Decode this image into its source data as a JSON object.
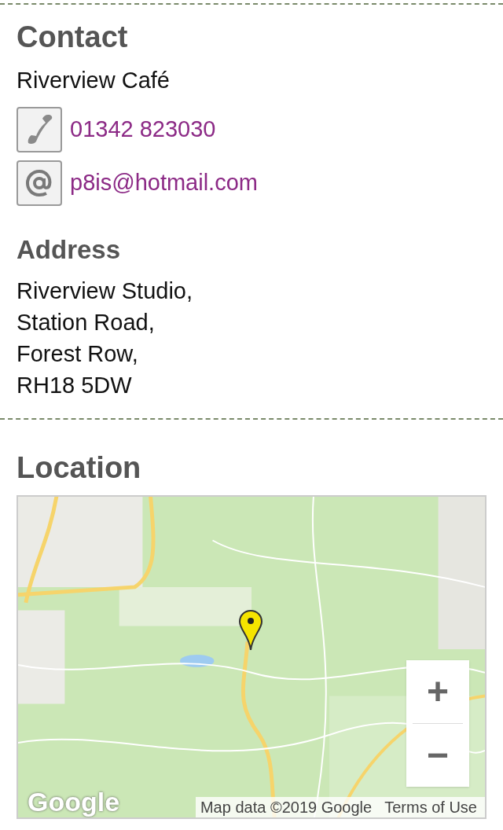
{
  "contact": {
    "heading": "Contact",
    "name": "Riverview Café",
    "links": [
      {
        "kind": "phone",
        "text": "01342 823030"
      },
      {
        "kind": "email",
        "text": "p8is@hotmail.com"
      }
    ]
  },
  "address": {
    "heading": "Address",
    "lines": [
      "Riverview Studio,",
      "Station Road,",
      "Forest Row,",
      "RH18 5DW"
    ]
  },
  "location": {
    "heading": "Location",
    "map": {
      "kind": "picture",
      "zoom_in": "+",
      "zoom_out": "−",
      "logo": "Google",
      "attribution": "Map data ©2019 Google",
      "terms": "Terms of Use"
    }
  }
}
